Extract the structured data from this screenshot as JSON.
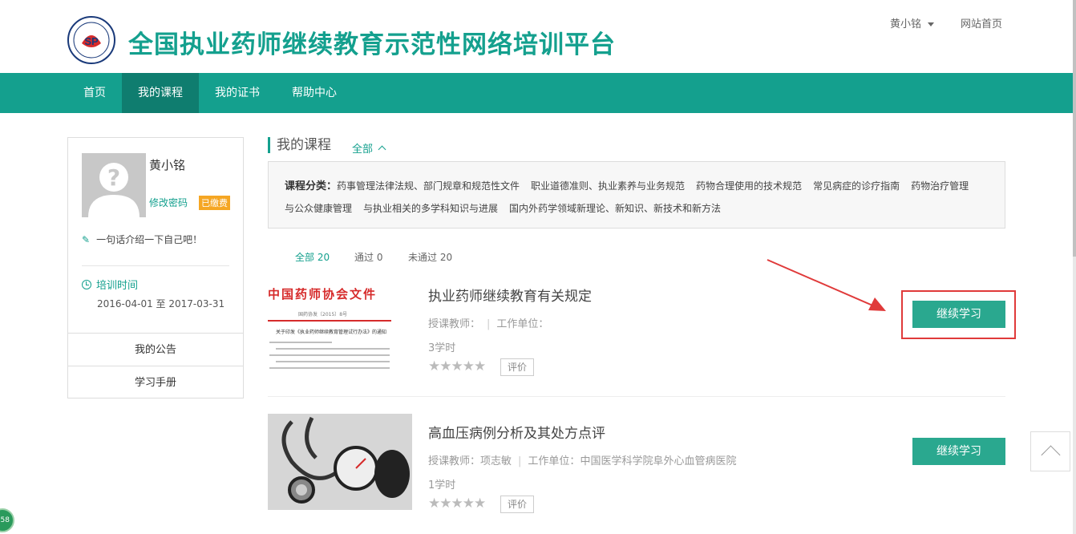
{
  "header": {
    "site_title": "全国执业药师继续教育示范性网络培训平台",
    "user_name": "黄小铭",
    "home_link": "网站首页",
    "brand_color": "#14a08e"
  },
  "nav": {
    "items": [
      {
        "label": "首页",
        "active": false
      },
      {
        "label": "我的课程",
        "active": true
      },
      {
        "label": "我的证书",
        "active": false
      },
      {
        "label": "帮助中心",
        "active": false
      }
    ]
  },
  "sidebar": {
    "name": "黄小铭",
    "change_password": "修改密码",
    "paid_badge": "已缴费",
    "bio": "一句话介绍一下自己吧！",
    "training_label": "培训时间",
    "training_range": "2016-04-01 至 2017-03-31",
    "links": [
      "我的公告",
      "学习手册"
    ]
  },
  "main": {
    "title": "我的课程",
    "filter": "全部",
    "category_label": "课程分类：",
    "categories_line1": [
      "药事管理法律法规、部门规章和规范性文件",
      "职业道德准则、执业素养与业务规范",
      "药物合理使用的技术规范",
      "常见病症的诊疗指南",
      "药物治疗管理"
    ],
    "categories_line2": [
      "与公众健康管理",
      "与执业相关的多学科知识与进展",
      "国内外药学领域新理论、新知识、新技术和新方法"
    ],
    "tabs": [
      {
        "label": "全部 20",
        "active": true
      },
      {
        "label": "通过 0",
        "active": false
      },
      {
        "label": "未通过 20",
        "active": false
      }
    ]
  },
  "courses": [
    {
      "title": "执业药师继续教育有关规定",
      "teacher_label": "授课教师：",
      "teacher": "",
      "unit_label": "工作单位：",
      "unit": "",
      "hours": "3学时",
      "rating": 0,
      "rate_label": "评价",
      "action_label": "继续学习",
      "thumb_doc_title": "中国药师协会文件",
      "thumb_doc_no": "国药协发〔2015〕8号",
      "thumb_doc_subject": "关于印发《执业药师继续教育管理试行办法》的通知"
    },
    {
      "title": "高血压病例分析及其处方点评",
      "teacher_label": "授课教师：",
      "teacher": "项志敏",
      "unit_label": "工作单位：",
      "unit": "中国医学科学院阜外心血管病医院",
      "hours": "1学时",
      "rating": 0,
      "rate_label": "评价",
      "action_label": "继续学习"
    }
  ],
  "corner_widget": "58"
}
